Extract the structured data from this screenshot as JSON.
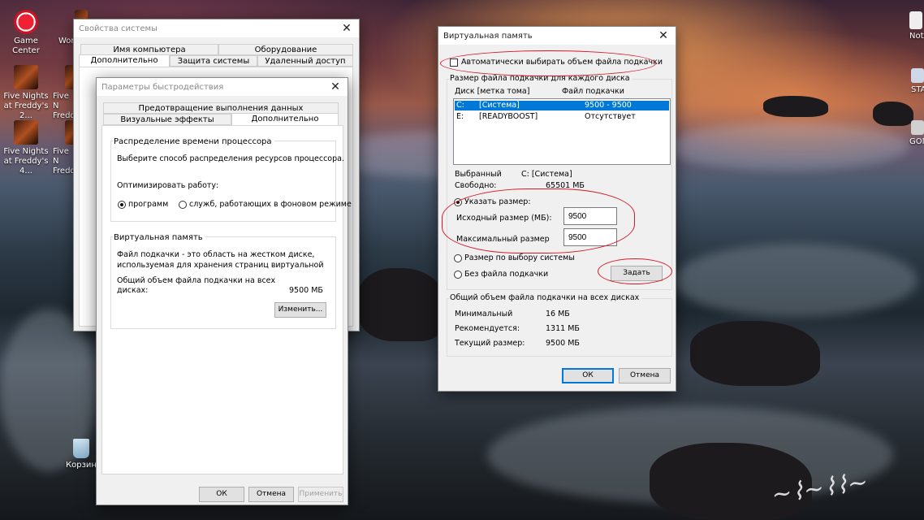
{
  "desktop": {
    "icons": [
      {
        "label": "Game Center"
      },
      {
        "label": "Wor"
      },
      {
        "label": "Five Nights at Freddy's 2..."
      },
      {
        "label": "Five N Freddy"
      },
      {
        "label": "Five Nights at Freddy's 4..."
      },
      {
        "label": "Five N Freddy"
      },
      {
        "label": "Корзин"
      },
      {
        "label": "Not"
      },
      {
        "label": "STA"
      },
      {
        "label": "GOM"
      }
    ]
  },
  "system_props": {
    "title": "Свойства системы",
    "tabs_row1": [
      "Имя компьютера",
      "Оборудование"
    ],
    "tabs_row2": [
      "Дополнительно",
      "Защита системы",
      "Удаленный доступ"
    ],
    "close_glyph": "✕"
  },
  "perf": {
    "title": "Параметры быстродействия",
    "close_glyph": "✕",
    "tabs_row1": [
      "Предотвращение выполнения данных"
    ],
    "tabs_row2": [
      "Визуальные эффекты",
      "Дополнительно"
    ],
    "cpu_group": {
      "title": "Распределение времени процессора",
      "desc": "Выберите способ распределения ресурсов процессора.",
      "optimize_label": "Оптимизировать работу:",
      "opt_programs": "программ",
      "opt_services": "служб, работающих в фоновом режиме"
    },
    "vm_group": {
      "title": "Виртуальная память",
      "desc_line1": "Файл подкачки - это область на жестком диске,",
      "desc_line2": "используемая для хранения страниц виртуальной",
      "total_line1": "Общий объем файла подкачки на всех",
      "total_line2": "дисках:",
      "total_value": "9500 МБ",
      "change_button": "Изменить..."
    },
    "buttons": {
      "ok": "ОК",
      "cancel": "Отмена",
      "apply": "Применить"
    }
  },
  "vm": {
    "title": "Виртуальная память",
    "close_glyph": "✕",
    "auto_label": "Автоматически выбирать объем файла подкачки",
    "per_disk_label": "Размер файла подкачки для каждого диска",
    "col_disk": "Диск [метка тома]",
    "col_file": "Файл подкачки",
    "drives": [
      {
        "drive": "C:",
        "label": "[Система]",
        "size": "9500 - 9500",
        "selected": true
      },
      {
        "drive": "E:",
        "label": "[READYBOOST]",
        "size": "Отсутствует",
        "selected": false
      }
    ],
    "selected_label": "Выбранный",
    "selected_value": "C:  [Система]",
    "free_label": "Свободно:",
    "free_value": "65501 МБ",
    "custom_size": "Указать размер:",
    "initial_label": "Исходный размер (МБ):",
    "initial_value": "9500",
    "max_label": "Максимальный размер",
    "max_value": "9500",
    "system_managed": "Размер по выбору системы",
    "no_paging": "Без файла подкачки",
    "set_button": "Задать",
    "total_group": "Общий объем файла подкачки на всех дисках",
    "min_label": "Минимальный",
    "min_value": "16 МБ",
    "rec_label": "Рекомендуется:",
    "rec_value": "1311 МБ",
    "cur_label": "Текущий размер:",
    "cur_value": "9500 МБ",
    "ok": "ОК",
    "cancel": "Отмена"
  },
  "colors": {
    "accent": "#0078d7",
    "annotation": "#d41a2a"
  }
}
